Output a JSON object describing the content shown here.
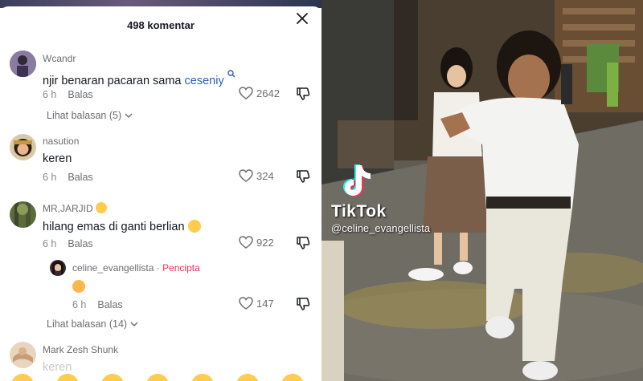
{
  "header": {
    "title": "498 komentar"
  },
  "comments": [
    {
      "username": "Wcandr",
      "text": "njir benaran pacaran sama ",
      "link": "ceseniy",
      "time": "6 h",
      "reply": "Balas",
      "likes": "2642",
      "view_replies": "Lihat balasan (5)"
    },
    {
      "username": "nasution",
      "text": "keren",
      "time": "6 h",
      "reply": "Balas",
      "likes": "324"
    },
    {
      "username": "MR,JARJID",
      "text": "hilang emas di ganti berlian",
      "time": "6 h",
      "reply": "Balas",
      "likes": "922",
      "view_replies": "Lihat balasan (14)"
    },
    {
      "username": "Mark Zesh Shunk",
      "text": "keren"
    }
  ],
  "reply": {
    "username": "celine_evangellista",
    "badge": "Pencipta",
    "time": "6 h",
    "reply": "Balas",
    "likes": "147"
  },
  "video": {
    "watermark": "TikTok",
    "handle": "@celine_evangellista"
  },
  "colors": {
    "accent_link": "#2b5db9",
    "creator": "#fe2c55",
    "emoji": "#ffcc4d"
  }
}
